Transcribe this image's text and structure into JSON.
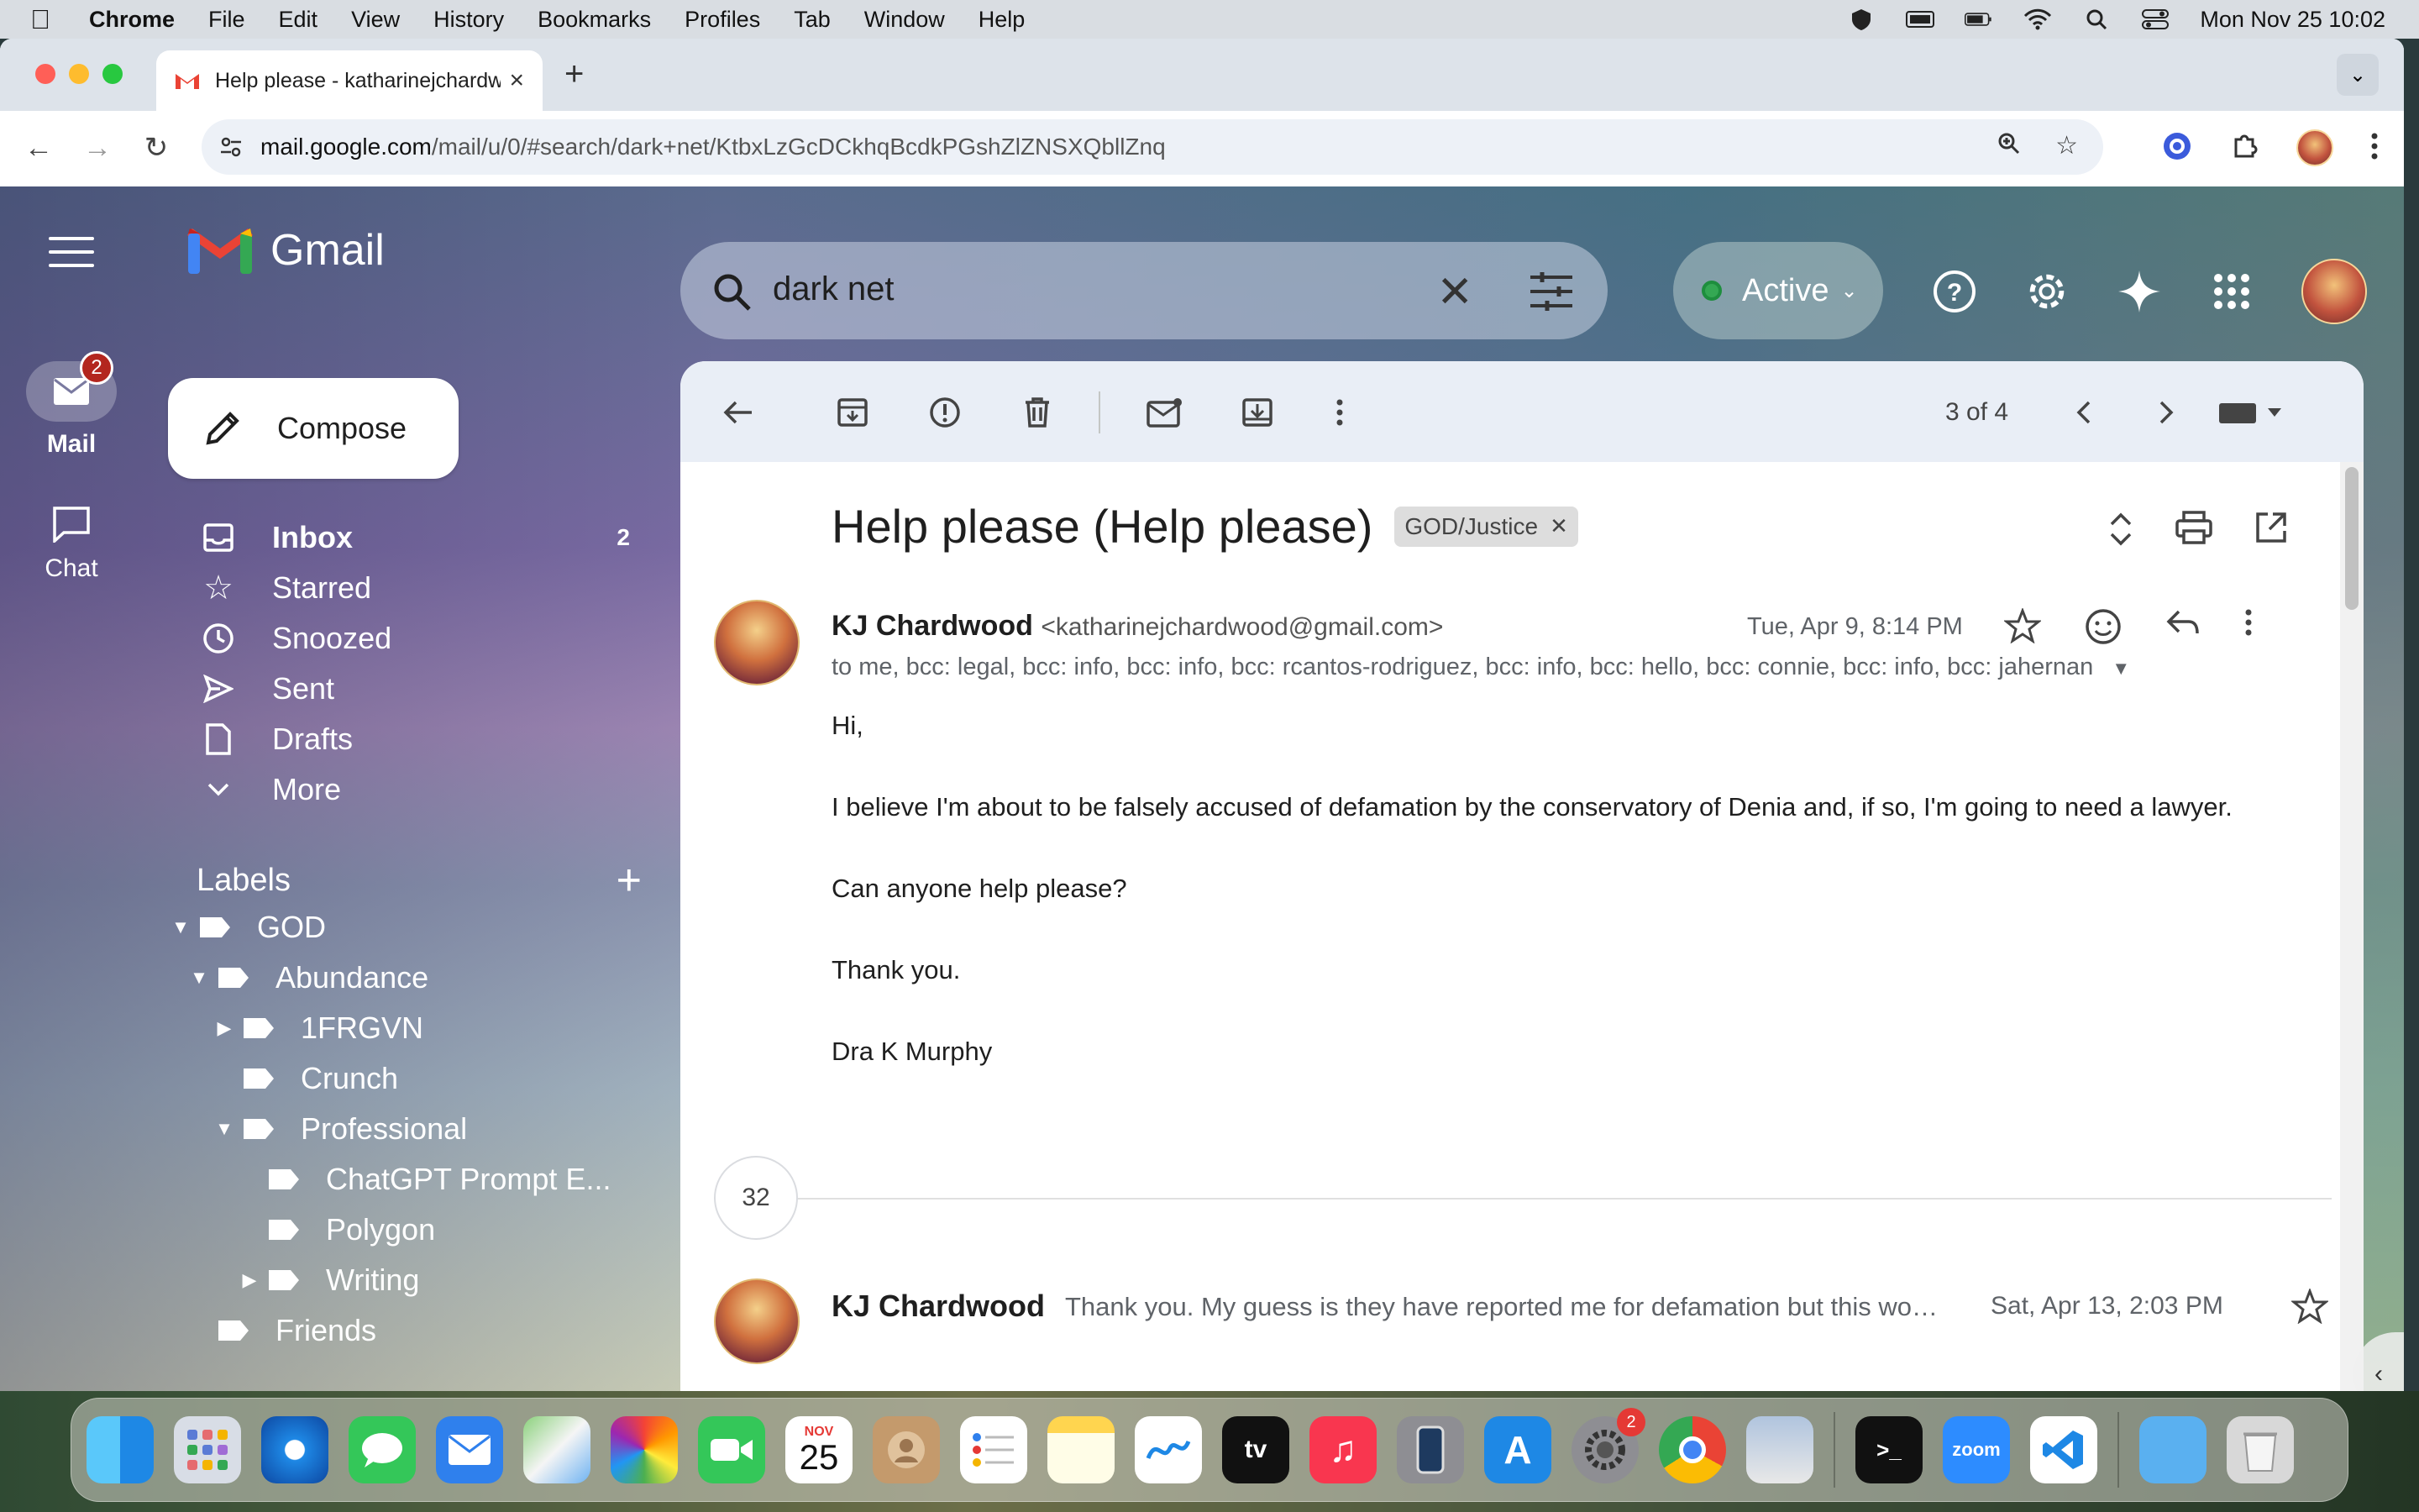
{
  "menubar": {
    "app": "Chrome",
    "items": [
      "File",
      "Edit",
      "View",
      "History",
      "Bookmarks",
      "Profiles",
      "Tab",
      "Window",
      "Help"
    ],
    "clock": "Mon Nov 25  10:02"
  },
  "browser": {
    "tab_title": "Help please - katharinejchardwood",
    "url_host": "mail.google.com",
    "url_path": "/mail/u/0/#search/dark+net/KtbxLzGcDCkhqBcdkPGshZlZNSXQbllZnq"
  },
  "gmail": {
    "logo": "Gmail",
    "search_query": "dark net",
    "status": "Active",
    "rail": {
      "mail_label": "Mail",
      "mail_badge": "2",
      "chat_label": "Chat"
    },
    "compose": "Compose",
    "nav": [
      {
        "label": "Inbox",
        "count": "2"
      },
      {
        "label": "Starred",
        "count": ""
      },
      {
        "label": "Snoozed",
        "count": ""
      },
      {
        "label": "Sent",
        "count": ""
      },
      {
        "label": "Drafts",
        "count": ""
      },
      {
        "label": "More",
        "count": ""
      }
    ],
    "labels_heading": "Labels",
    "labels": [
      "GOD",
      "Abundance",
      "1FRGVN",
      "Crunch",
      "Professional",
      "ChatGPT Prompt E...",
      "Polygon",
      "Writing",
      "Friends"
    ]
  },
  "message": {
    "pager": "3 of 4",
    "subject": "Help please (Help please)",
    "label_chip": "GOD/Justice",
    "sender_name": "KJ Chardwood",
    "sender_email": "<katharinejchardwood@gmail.com>",
    "date": "Tue, Apr 9, 8:14 PM",
    "recipients": "to me, bcc: legal, bcc: info, bcc: info, bcc: rcantos-rodriguez, bcc: info, bcc: hello, bcc: connie, bcc: info, bcc: jahernan",
    "body": [
      "Hi,",
      "I believe I'm about to be falsely accused of defamation by the conservatory of Denia and, if so, I'm going to need a lawyer.",
      "Can anyone help please?",
      "Thank you.",
      "Dra K Murphy"
    ],
    "collapsed_count": "32",
    "next_sender": "KJ Chardwood",
    "next_snippet": "Thank you. My guess is they have reported me for defamation but this wo…",
    "next_date": "Sat, Apr 13, 2:03 PM"
  },
  "dock": {
    "calendar_month": "NOV",
    "calendar_day": "25",
    "settings_badge": "2",
    "zoom_label": "zoom"
  },
  "colors": {
    "gmail_red": "#ea4335",
    "active_green": "#34a853",
    "badge_red": "#b3261e"
  }
}
